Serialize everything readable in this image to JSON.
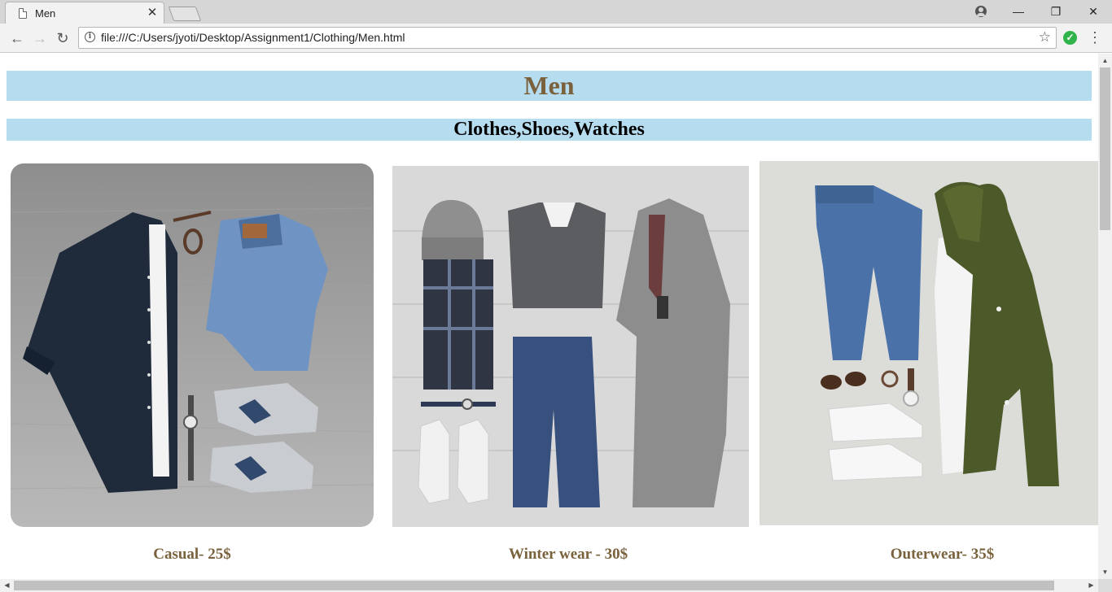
{
  "browser": {
    "tab_title": "Men",
    "tab_close": "✕",
    "url": "file:///C:/Users/jyoti/Desktop/Assignment1/Clothing/Men.html",
    "window_controls": {
      "minimize": "—",
      "restore": "❐",
      "close": "✕"
    },
    "nav": {
      "back": "←",
      "forward": "→",
      "reload": "↻"
    },
    "icons": {
      "info": "i",
      "star": "☆",
      "extension_check": "✓",
      "menu": "⋮"
    }
  },
  "page": {
    "heading": "Men",
    "subheading": "Clothes,Shoes,Watches",
    "products": [
      {
        "caption": "Casual- 25$",
        "image": "casual-outfit-flatlay"
      },
      {
        "caption": "Winter wear - 30$",
        "image": "winter-outfit-flatlay"
      },
      {
        "caption": "Outerwear- 35$",
        "image": "outerwear-outfit-flatlay"
      }
    ]
  },
  "colors": {
    "heading_bg": "#b6dcef",
    "heading_text": "#7a623d",
    "subheading_text": "#000000",
    "caption_text": "#7a623d"
  }
}
